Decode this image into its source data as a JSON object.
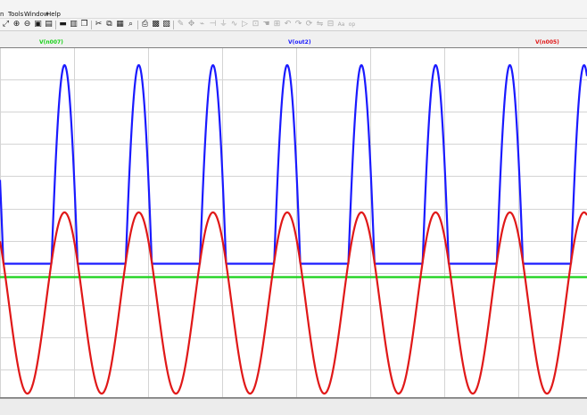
{
  "menu": [
    {
      "id": "view",
      "label": "n"
    },
    {
      "id": "tools",
      "label": "Tools"
    },
    {
      "id": "window",
      "label": "Window"
    },
    {
      "id": "help",
      "label": "Help"
    }
  ],
  "toolbar": [
    {
      "name": "zoom-full-extent",
      "glyph": "⤢",
      "enabled": true
    },
    {
      "name": "zoom-in",
      "glyph": "⊕",
      "enabled": true
    },
    {
      "name": "zoom-out",
      "glyph": "⊖",
      "enabled": true
    },
    {
      "name": "zoom-to-fit",
      "glyph": "▣",
      "enabled": true
    },
    {
      "name": "autorange",
      "glyph": "▤",
      "enabled": true
    },
    {
      "sep": true
    },
    {
      "name": "tile-vertically",
      "glyph": "▬",
      "enabled": true
    },
    {
      "name": "tile-horizontally",
      "glyph": "▥",
      "enabled": true
    },
    {
      "name": "cascade-windows",
      "glyph": "❐",
      "enabled": true
    },
    {
      "sep": true
    },
    {
      "name": "cut",
      "glyph": "✂",
      "enabled": true
    },
    {
      "name": "copy",
      "glyph": "⧉",
      "enabled": true
    },
    {
      "name": "paste",
      "glyph": "▦",
      "enabled": true
    },
    {
      "name": "find",
      "glyph": "⌕",
      "enabled": true
    },
    {
      "sep": true
    },
    {
      "name": "print",
      "glyph": "⎙",
      "enabled": true
    },
    {
      "name": "print-preview",
      "glyph": "▩",
      "enabled": true
    },
    {
      "name": "print-setup",
      "glyph": "▧",
      "enabled": true
    },
    {
      "sep": true
    },
    {
      "name": "pencil",
      "glyph": "✎",
      "enabled": false
    },
    {
      "name": "move",
      "glyph": "✥",
      "enabled": false
    },
    {
      "name": "resistor",
      "glyph": "⌁",
      "enabled": false
    },
    {
      "name": "capacitor",
      "glyph": "⊣",
      "enabled": false
    },
    {
      "name": "ground",
      "glyph": "⏚",
      "enabled": false
    },
    {
      "name": "inductor",
      "glyph": "∿",
      "enabled": false
    },
    {
      "name": "diode",
      "glyph": "▷",
      "enabled": false
    },
    {
      "name": "component",
      "glyph": "⊡",
      "enabled": false
    },
    {
      "name": "hand",
      "glyph": "☚",
      "enabled": false
    },
    {
      "name": "label",
      "glyph": "⊞",
      "enabled": false
    },
    {
      "name": "undo",
      "glyph": "↶",
      "enabled": false
    },
    {
      "name": "redo",
      "glyph": "↷",
      "enabled": false
    },
    {
      "name": "rotate",
      "glyph": "⟳",
      "enabled": false
    },
    {
      "name": "mirror",
      "glyph": "⇋",
      "enabled": false
    },
    {
      "name": "spice-directive",
      "glyph": "⊟",
      "enabled": false
    },
    {
      "name": "text",
      "glyph": "Aa",
      "enabled": false
    },
    {
      "name": "op",
      "glyph": "op",
      "enabled": false
    }
  ],
  "traces": [
    {
      "label": "V(n007)",
      "color": "#19d219"
    },
    {
      "label": "V(out2)",
      "color": "#1a1aff"
    },
    {
      "label": "V(n005)",
      "color": "#e01818"
    }
  ],
  "colors": {
    "background": "#ffffff",
    "grid": "#d4d4d4",
    "plot_border": "#7f7f7f"
  },
  "waveform": {
    "cycles_visible": 8.1,
    "phase_degrees": 137,
    "sine_n005_normalized_swing": [
      -1.0,
      1.0
    ],
    "dc_n007_normalized_level": 0.0,
    "rectified_out2_peak": 1.57,
    "rectified_out2_floor": 0.0
  }
}
